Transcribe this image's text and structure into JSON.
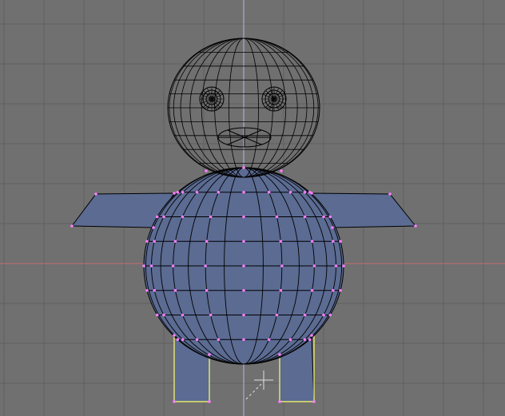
{
  "viewport": {
    "mode": "edit",
    "view": "front-orthographic",
    "background_color": "#707070",
    "grid_color": "#5f5f5f",
    "grid_major_color": "#555555",
    "axis_x_color": "#c46a6a",
    "axis_z_color": "#b8b8e6"
  },
  "model": {
    "name_hint": "penguin-character",
    "wire_color": "#000000",
    "selected_face_color": "#5b6b92",
    "selected_vertex_color": "#ff7dff",
    "selected_edge_color": "#ffff66"
  },
  "cursor": {
    "icon": "3d-cursor-icon",
    "color": "#e0e0e0"
  }
}
